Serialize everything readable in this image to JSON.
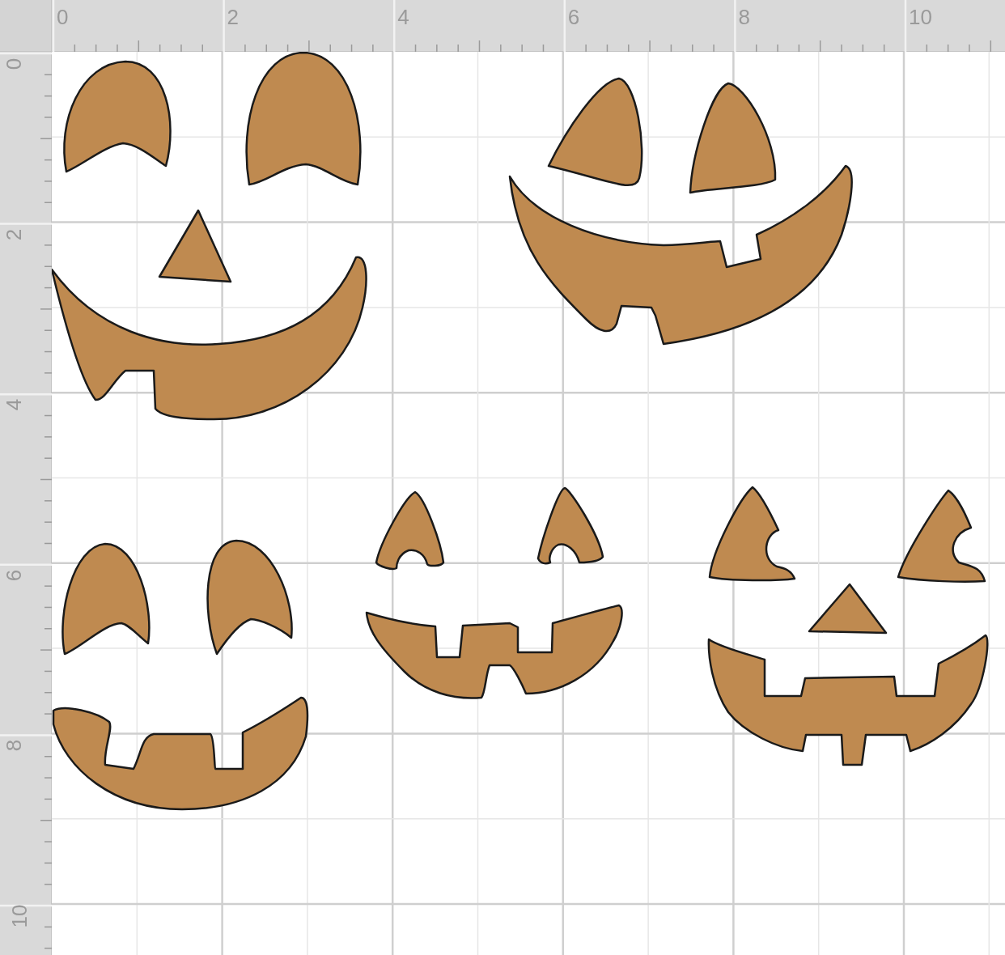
{
  "rulers": {
    "horizontal": [
      "0",
      "2",
      "4",
      "6",
      "8",
      "10"
    ],
    "vertical": [
      "0",
      "2",
      "4",
      "6",
      "8",
      "10"
    ]
  }
}
